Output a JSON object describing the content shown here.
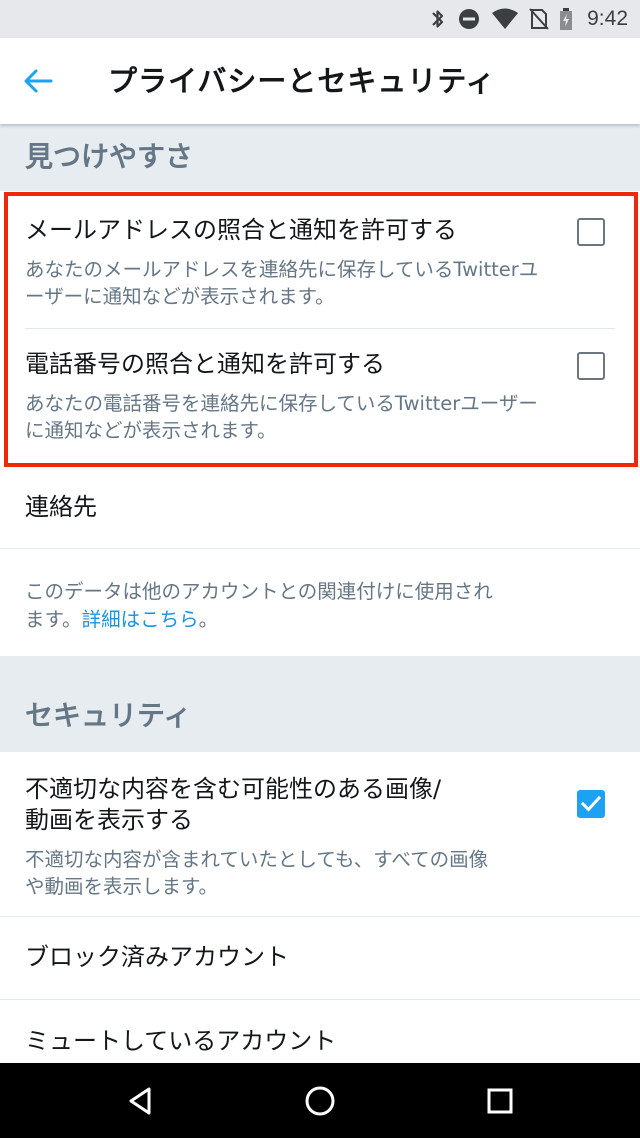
{
  "status_bar": {
    "time": "9:42",
    "icons": [
      "bluetooth-icon",
      "do-not-disturb-icon",
      "wifi-icon",
      "no-sim-icon",
      "battery-icon"
    ]
  },
  "app_bar": {
    "title": "プライバシーとセキュリティ",
    "back_icon": "arrow-left-icon"
  },
  "sections": {
    "discoverability": {
      "header": "見つけやすさ",
      "email": {
        "title": "メールアドレスの照合と通知を許可する",
        "desc_line1": "あなたのメールアドレスを連絡先に保存しているTwitterユ",
        "desc_line2": "ーザーに通知などが表示されます。",
        "checked": false
      },
      "phone": {
        "title": "電話番号の照合と通知を許可する",
        "desc_line1": "あなたの電話番号を連絡先に保存しているTwitterユーザー",
        "desc_line2": "に通知などが表示されます。",
        "checked": false
      },
      "contacts": {
        "title": "連絡先"
      },
      "info": {
        "line1": "このデータは他のアカウントとの関連付けに使用され",
        "line2_prefix": "ます。",
        "link": "詳細はこちら",
        "line2_suffix": "。"
      }
    },
    "security": {
      "header": "セキュリティ",
      "sensitive_media": {
        "title_line1": "不適切な内容を含む可能性のある画像/",
        "title_line2": "動画を表示する",
        "desc_line1": "不適切な内容が含まれていたとしても、すべての画像",
        "desc_line2": "や動画を表示します。",
        "checked": true
      },
      "blocked": {
        "title": "ブロック済みアカウント"
      },
      "muted": {
        "title": "ミュートしているアカウント"
      }
    }
  },
  "colors": {
    "accent": "#1da1f2",
    "highlight": "#f0280a",
    "section_bg": "#e6ecf0",
    "secondary_text": "#657786"
  },
  "nav_bar": {
    "icons": [
      "back-triangle-icon",
      "home-circle-icon",
      "recents-square-icon"
    ]
  }
}
